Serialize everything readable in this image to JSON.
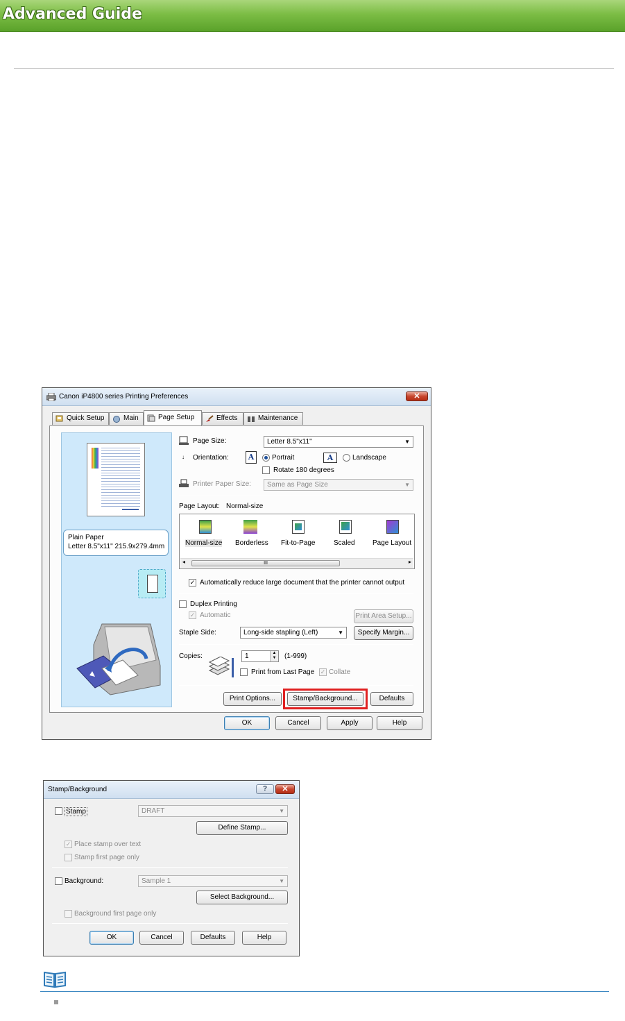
{
  "header": {
    "title": "Advanced Guide"
  },
  "prefs_dialog": {
    "title": "Canon iP4800 series Printing Preferences",
    "close": "✕",
    "tabs": [
      "Quick Setup",
      "Main",
      "Page Setup",
      "Effects",
      "Maintenance"
    ],
    "active_tab": "Page Setup",
    "paper_info": {
      "line1": "Plain Paper",
      "line2": "Letter 8.5\"x11\" 215.9x279.4mm"
    },
    "page_size_label": "Page Size:",
    "page_size_value": "Letter 8.5\"x11\"",
    "orientation_label": "Orientation:",
    "portrait": "Portrait",
    "landscape": "Landscape",
    "rotate_180": "Rotate 180 degrees",
    "printer_paper_size_label": "Printer Paper Size:",
    "printer_paper_size_value": "Same as Page Size",
    "page_layout_label": "Page Layout:",
    "page_layout_value": "Normal-size",
    "layouts": [
      "Normal-size",
      "Borderless",
      "Fit-to-Page",
      "Scaled",
      "Page Layout"
    ],
    "scroll_mark": "III",
    "auto_reduce": "Automatically reduce large document that the printer cannot output",
    "duplex_printing": "Duplex Printing",
    "automatic": "Automatic",
    "print_area_setup": "Print Area Setup...",
    "staple_side_label": "Staple Side:",
    "staple_side_value": "Long-side stapling (Left)",
    "specify_margin": "Specify Margin...",
    "copies_label": "Copies:",
    "copies_value": "1",
    "copies_range": "(1-999)",
    "print_from_last_page": "Print from Last Page",
    "collate": "Collate",
    "print_options": "Print Options...",
    "stamp_background": "Stamp/Background...",
    "defaults": "Defaults",
    "ok": "OK",
    "cancel": "Cancel",
    "apply": "Apply",
    "help": "Help",
    "highlight_color": "#e02020"
  },
  "stamp_dialog": {
    "title": "Stamp/Background",
    "help": "?",
    "close": "✕",
    "stamp_label": "Stamp",
    "stamp_value": "DRAFT",
    "define_stamp": "Define Stamp...",
    "place_over_text": "Place stamp over text",
    "stamp_first_page": "Stamp first page only",
    "background_label": "Background:",
    "background_value": "Sample 1",
    "select_background": "Select Background...",
    "background_first_page": "Background first page only",
    "ok": "OK",
    "cancel": "Cancel",
    "defaults": "Defaults",
    "help_btn": "Help"
  },
  "colors": {
    "banner_green": "#6db33a",
    "note_blue": "#3c88c2"
  },
  "icons": [
    "printer-icon",
    "note-book-icon"
  ]
}
